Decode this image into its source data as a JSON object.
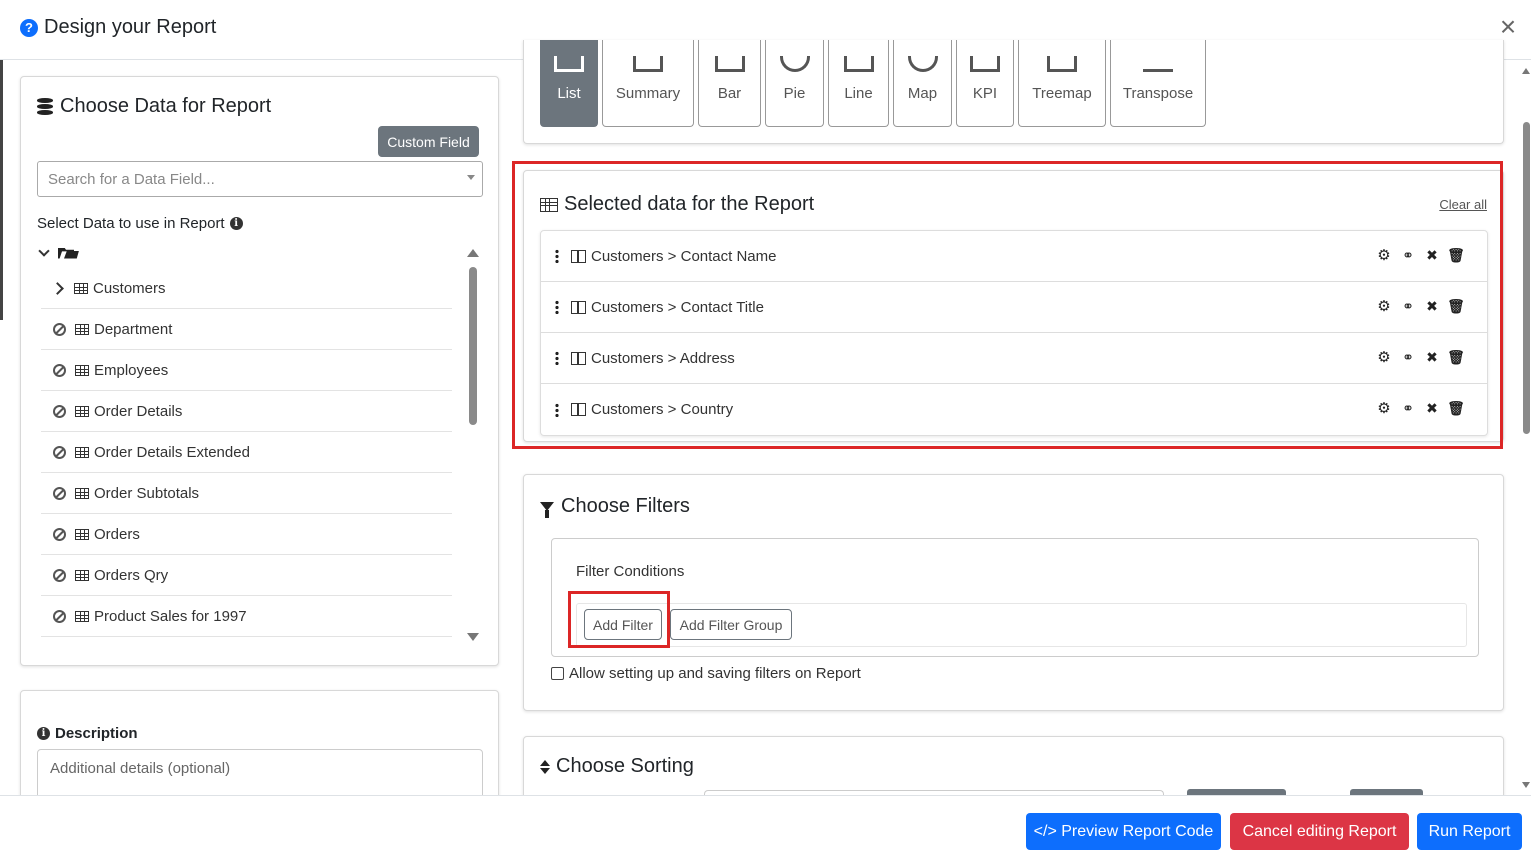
{
  "header": {
    "title": "Design your Report",
    "close_glyph": "×"
  },
  "choose_data": {
    "title": "Choose Data for Report",
    "custom_field_label": "Custom Field",
    "search_placeholder": "Search for a Data Field...",
    "select_label": "Select Data to use in Report",
    "tables": [
      {
        "name": "Customers",
        "expandable": true
      },
      {
        "name": "Department",
        "expandable": false
      },
      {
        "name": "Employees",
        "expandable": false
      },
      {
        "name": "Order Details",
        "expandable": false
      },
      {
        "name": "Order Details Extended",
        "expandable": false
      },
      {
        "name": "Order Subtotals",
        "expandable": false
      },
      {
        "name": "Orders",
        "expandable": false
      },
      {
        "name": "Orders Qry",
        "expandable": false
      },
      {
        "name": "Product Sales for 1997",
        "expandable": false
      }
    ]
  },
  "description": {
    "title": "Description",
    "placeholder": "Additional details (optional)"
  },
  "chart_types": {
    "active": "List",
    "items": [
      "List",
      "Summary",
      "Bar",
      "Pie",
      "Line",
      "Map",
      "KPI",
      "Treemap",
      "Transpose"
    ]
  },
  "selected_data": {
    "title": "Selected data for the Report",
    "clear_all": "Clear all",
    "rows": [
      {
        "label": "Customers > Contact Name"
      },
      {
        "label": "Customers > Contact Title"
      },
      {
        "label": "Customers > Address"
      },
      {
        "label": "Customers > Country"
      }
    ]
  },
  "filters": {
    "title": "Choose Filters",
    "conditions_label": "Filter Conditions",
    "add_filter": "Add Filter",
    "add_filter_group": "Add Filter Group",
    "allow_label": "Allow setting up and saving filters on Report",
    "allow_checked": false
  },
  "sorting": {
    "title": "Choose Sorting"
  },
  "footer": {
    "preview_label": "</> Preview Report Code",
    "cancel_label": "Cancel editing Report",
    "run_label": "Run Report"
  },
  "colors": {
    "primary": "#0d6efd",
    "danger": "#dc3545",
    "secondary": "#6c757d",
    "highlight": "#dc2626"
  }
}
